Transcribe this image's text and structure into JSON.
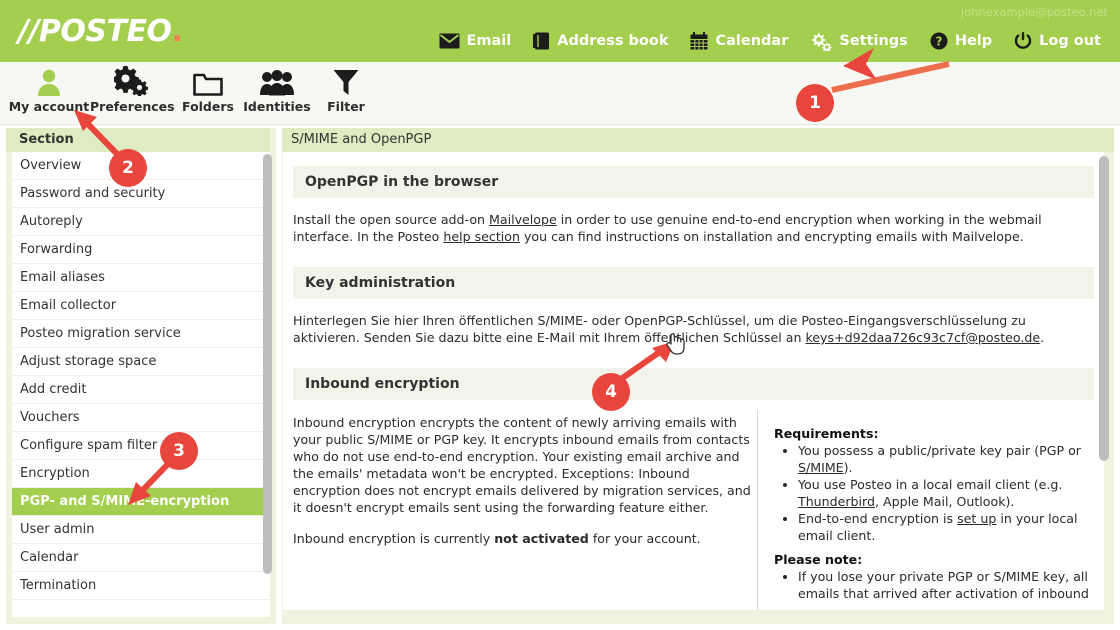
{
  "header": {
    "logo_text": "//POSTEO",
    "logo_dot": ".",
    "account_email": "johnexample@posteo.net",
    "nav": [
      {
        "label": "Email",
        "icon": "envelope-icon"
      },
      {
        "label": "Address book",
        "icon": "address-book-icon"
      },
      {
        "label": "Calendar",
        "icon": "calendar-icon"
      },
      {
        "label": "Settings",
        "icon": "gear-icon"
      },
      {
        "label": "Help",
        "icon": "question-mark-icon"
      },
      {
        "label": "Log out",
        "icon": "power-icon"
      }
    ]
  },
  "toolbar": {
    "items": [
      {
        "label": "My account",
        "icon": "user-icon"
      },
      {
        "label": "Preferences",
        "icon": "gears-icon"
      },
      {
        "label": "Folders",
        "icon": "folder-icon"
      },
      {
        "label": "Identities",
        "icon": "people-icon"
      },
      {
        "label": "Filter",
        "icon": "funnel-icon"
      }
    ]
  },
  "sidebar": {
    "header": "Section",
    "items": [
      {
        "label": "Overview",
        "active": false
      },
      {
        "label": "Password and security",
        "active": false
      },
      {
        "label": "Autoreply",
        "active": false
      },
      {
        "label": "Forwarding",
        "active": false
      },
      {
        "label": "Email aliases",
        "active": false
      },
      {
        "label": "Email collector",
        "active": false
      },
      {
        "label": "Posteo migration service",
        "active": false
      },
      {
        "label": "Adjust storage space",
        "active": false
      },
      {
        "label": "Add credit",
        "active": false
      },
      {
        "label": "Vouchers",
        "active": false
      },
      {
        "label": "Configure spam filter",
        "active": false
      },
      {
        "label": "Encryption",
        "active": false
      },
      {
        "label": "PGP- and S/MIME-encryption",
        "active": true
      },
      {
        "label": "User admin",
        "active": false
      },
      {
        "label": "Calendar",
        "active": false
      },
      {
        "label": "Termination",
        "active": false
      }
    ]
  },
  "main": {
    "title": "S/MIME and OpenPGP",
    "openpgp": {
      "heading": "OpenPGP in the browser",
      "text_1": "Install the open source add-on ",
      "link_mailvelope": "Mailvelope",
      "text_2": " in order to use genuine end-to-end encryption when working in the webmail interface. In the Posteo ",
      "link_help_section": "help section",
      "text_3": " you can find instructions on installation and encrypting emails with Mailvelope."
    },
    "key_admin": {
      "heading": "Key administration",
      "text_1": "Hinterlegen Sie hier Ihren öffentlichen S/MIME- oder OpenPGP-Schlüssel, um die Posteo-Eingangsverschlüsselung zu aktivieren. Senden Sie dazu bitte eine E-Mail mit Ihrem öffentlichen Schlüssel an ",
      "key_email": "keys+d92daa726c93c7cf@posteo.de",
      "text_2": "."
    },
    "inbound": {
      "heading": "Inbound encryption",
      "description": "Inbound encryption encrypts the content of newly arriving emails with your public S/MIME or PGP key. It encrypts inbound emails from contacts who do not use end-to-end encryption. Your existing email archive and the emails' metadata won't be encrypted. Exceptions: Inbound encryption does not encrypt emails delivered by migration services, and it doesn't encrypt emails sent using the forwarding feature either.",
      "status_prefix": "Inbound encryption is currently ",
      "status_value": "not activated",
      "status_suffix": " for your account."
    },
    "requirements": {
      "heading": "Requirements",
      "heading_colon": ":",
      "items": [
        {
          "pre": "You possess a public/private key pair (PGP or ",
          "link": "S/MIME",
          "post": ")."
        },
        {
          "pre": "You use Posteo in a local email client (e.g. ",
          "link": "Thunderbird",
          "post": ", Apple Mail, Outlook)."
        },
        {
          "pre": "End-to-end encryption is ",
          "link": "set up",
          "post": " in your local email client."
        }
      ],
      "note_heading": "Please note",
      "note_heading_colon": ":",
      "note_items": [
        "If you lose your private PGP or S/MIME key, all emails that arrived after activation of inbound"
      ]
    }
  },
  "annotations": {
    "color": "#e8453c",
    "markers": [
      {
        "number": "1",
        "target": "settings-nav-item"
      },
      {
        "number": "2",
        "target": "my-account-toolbar-item"
      },
      {
        "number": "3",
        "target": "pgp-smime-sidebar-item"
      },
      {
        "number": "4",
        "target": "key-email-link"
      }
    ]
  },
  "colors": {
    "brand_green": "#a3ce4e",
    "pale_green": "#dfecc2",
    "panel_green": "#eef4e0",
    "accent_orange": "#ee7141",
    "annotation_red": "#e8453c"
  }
}
